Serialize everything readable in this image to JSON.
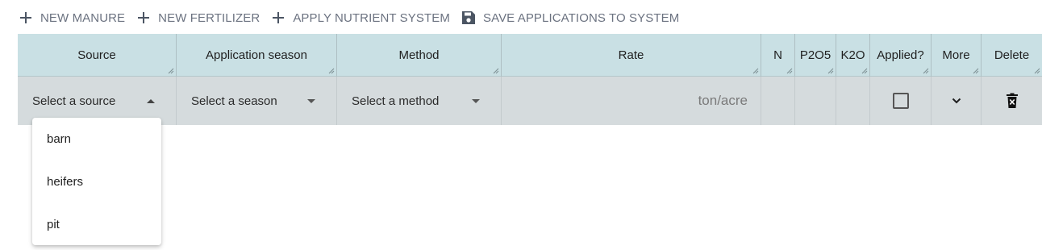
{
  "toolbar": {
    "new_manure": "NEW MANURE",
    "new_fertilizer": "NEW FERTILIZER",
    "apply_nutrient_system": "APPLY NUTRIENT SYSTEM",
    "save_applications": "SAVE APPLICATIONS TO SYSTEM"
  },
  "table": {
    "columns": [
      "Source",
      "Application season",
      "Method",
      "Rate",
      "N",
      "P2O5",
      "K2O",
      "Applied?",
      "More",
      "Delete"
    ],
    "row": {
      "source_placeholder": "Select a source",
      "season_placeholder": "Select a season",
      "method_placeholder": "Select a method",
      "rate_unit": "ton/acre",
      "n": "",
      "p2o5": "",
      "k2o": "",
      "applied": false
    }
  },
  "source_dropdown": {
    "open": true,
    "options": [
      "barn",
      "heifers",
      "pit"
    ]
  },
  "colors": {
    "header_bg": "#c9e0e4",
    "row_bg": "#d5dbdd",
    "toolbar_text": "#6b7280"
  }
}
